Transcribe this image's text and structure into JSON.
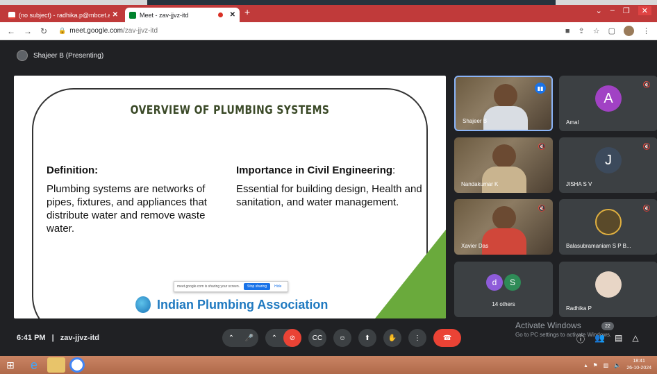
{
  "browser": {
    "tabs": [
      {
        "title": "(no subject) - radhika.p@mbcet.a",
        "active": false
      },
      {
        "title": "Meet - zav-jjvz-itd",
        "active": true
      }
    ],
    "url_host": "meet.google.com",
    "url_path": "/zav-jjvz-itd"
  },
  "meet": {
    "presenter_label": "Shajeer B (Presenting)",
    "time": "6:41 PM",
    "separator": "|",
    "meeting_code": "zav-jjvz-itd"
  },
  "slide": {
    "title": "OVERVIEW OF PLUMBING SYSTEMS",
    "definition_heading": "Definition:",
    "definition_text": "Plumbing systems are networks of pipes, fixtures, and appliances that distribute water and remove waste water.",
    "importance_heading": "Importance in Civil Engineering",
    "importance_colon": ":",
    "importance_text": "Essential for building design, Health and sanitation, and water management.",
    "org_name": "Indian Plumbing Association"
  },
  "share_bar": {
    "message": "meet.google.com is sharing your screen.",
    "stop_label": "Stop sharing",
    "hide_label": "Hide"
  },
  "participants": [
    {
      "name": "Shajeer B",
      "type": "video"
    },
    {
      "name": "Amal",
      "type": "avatar",
      "initial": "A",
      "color": "#a142c4"
    },
    {
      "name": "Nandakumar K",
      "type": "video"
    },
    {
      "name": "JISHA S V",
      "type": "avatar",
      "initial": "J",
      "color": "#3c4a5c"
    },
    {
      "name": "Xavier Das",
      "type": "video"
    },
    {
      "name": "Balasubramaniam S P B...",
      "type": "photo"
    },
    {
      "name": "14 others",
      "type": "group",
      "initials": [
        "d",
        "S"
      ]
    },
    {
      "name": "Radhika P",
      "type": "photo"
    }
  ],
  "watermark": {
    "line1": "Activate Windows",
    "line2": "Go to PC settings to activate Windows.",
    "badge": "22"
  },
  "taskbar": {
    "clock_time": "18:41",
    "clock_date": "26-10-2024"
  },
  "colors": {
    "tab_bar": "#c03a3a",
    "meet_bg": "#202124",
    "end_call": "#ea4335",
    "slide_green": "#6aaa3c",
    "ipa_blue": "#1f79c0"
  }
}
